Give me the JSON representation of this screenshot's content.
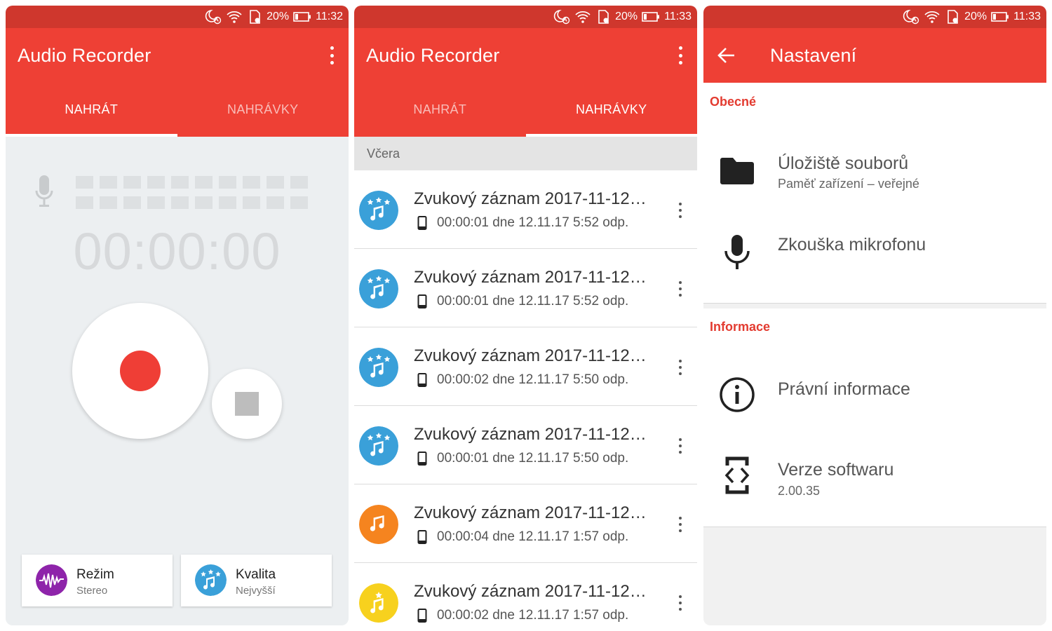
{
  "status_bar": {
    "screen1": {
      "battery": "20%",
      "time": "11:32"
    },
    "screen2": {
      "battery": "20%",
      "time": "11:33"
    },
    "screen3": {
      "battery": "20%",
      "time": "11:33"
    }
  },
  "recorder_screen": {
    "app_title": "Audio Recorder",
    "tabs": [
      {
        "label": "NAHRÁT",
        "active": true
      },
      {
        "label": "NAHRÁVKY",
        "active": false
      }
    ],
    "timer": "00:00:00",
    "mode_card": {
      "title": "Režim",
      "value": "Stereo",
      "icon": "waveform-icon",
      "color": "#8e24aa"
    },
    "quality_card": {
      "title": "Kvalita",
      "value": "Nejvyšší",
      "icon": "music-stars-icon",
      "color": "#3aa0d9"
    },
    "record_color": "#ef3e36"
  },
  "recordings_screen": {
    "app_title": "Audio Recorder",
    "tabs": [
      {
        "label": "NAHRÁT",
        "active": false
      },
      {
        "label": "NAHRÁVKY",
        "active": true
      }
    ],
    "section": "Včera",
    "items": [
      {
        "title": "Zvukový záznam 2017-11-12…",
        "meta": "00:00:01 dne 12.11.17 5:52 odp.",
        "icon_color": "#3aa0d9",
        "icon": "music-stars-icon"
      },
      {
        "title": "Zvukový záznam 2017-11-12…",
        "meta": "00:00:01 dne 12.11.17 5:52 odp.",
        "icon_color": "#3aa0d9",
        "icon": "music-stars-icon"
      },
      {
        "title": "Zvukový záznam 2017-11-12…",
        "meta": "00:00:02 dne 12.11.17 5:50 odp.",
        "icon_color": "#3aa0d9",
        "icon": "music-stars-icon"
      },
      {
        "title": "Zvukový záznam 2017-11-12…",
        "meta": "00:00:01 dne 12.11.17 5:50 odp.",
        "icon_color": "#3aa0d9",
        "icon": "music-stars-icon"
      },
      {
        "title": "Zvukový záznam 2017-11-12…",
        "meta": "00:00:04 dne 12.11.17 1:57 odp.",
        "icon_color": "#f5841f",
        "icon": "music-note-icon"
      },
      {
        "title": "Zvukový záznam 2017-11-12…",
        "meta": "00:00:02 dne 12.11.17 1:57 odp.",
        "icon_color": "#f7d11e",
        "icon": "music-star-icon"
      }
    ]
  },
  "settings_screen": {
    "title": "Nastavení",
    "general_header": "Obecné",
    "storage": {
      "title": "Úložiště souborů",
      "subtitle": "Paměť zařízení – veřejné"
    },
    "mic_test": {
      "title": "Zkouška mikrofonu"
    },
    "info_header": "Informace",
    "legal": {
      "title": "Právní informace"
    },
    "version": {
      "title": "Verze softwaru",
      "subtitle": "2.00.35"
    }
  },
  "colors": {
    "accent": "#ee4035",
    "status_bar": "#cf372d"
  }
}
